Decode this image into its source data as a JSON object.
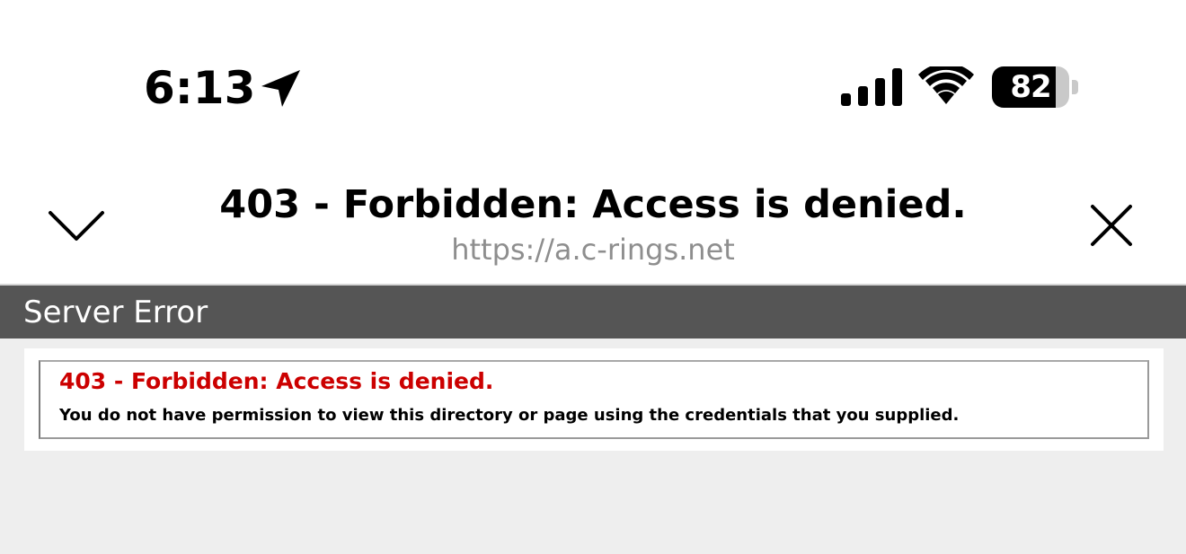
{
  "status_bar": {
    "time": "6:13",
    "battery_level": 82,
    "battery_label": "82",
    "icons": [
      "location-arrow-icon",
      "cellular-signal-icon",
      "wifi-icon",
      "battery-icon"
    ]
  },
  "nav_header": {
    "title": "403 - Forbidden: Access is denied.",
    "url": "https://a.c-rings.net",
    "icons": [
      "chevron-down-icon",
      "close-icon"
    ]
  },
  "page": {
    "header_title": "Server Error",
    "error_heading": "403 - Forbidden: Access is denied.",
    "error_message": "You do not have permission to view this directory or page using the credentials that you supplied."
  },
  "colors": {
    "header_bar": "#555555",
    "error_red": "#cc0000",
    "page_background": "#eeeeee",
    "url_gray": "#8e8e8e"
  }
}
